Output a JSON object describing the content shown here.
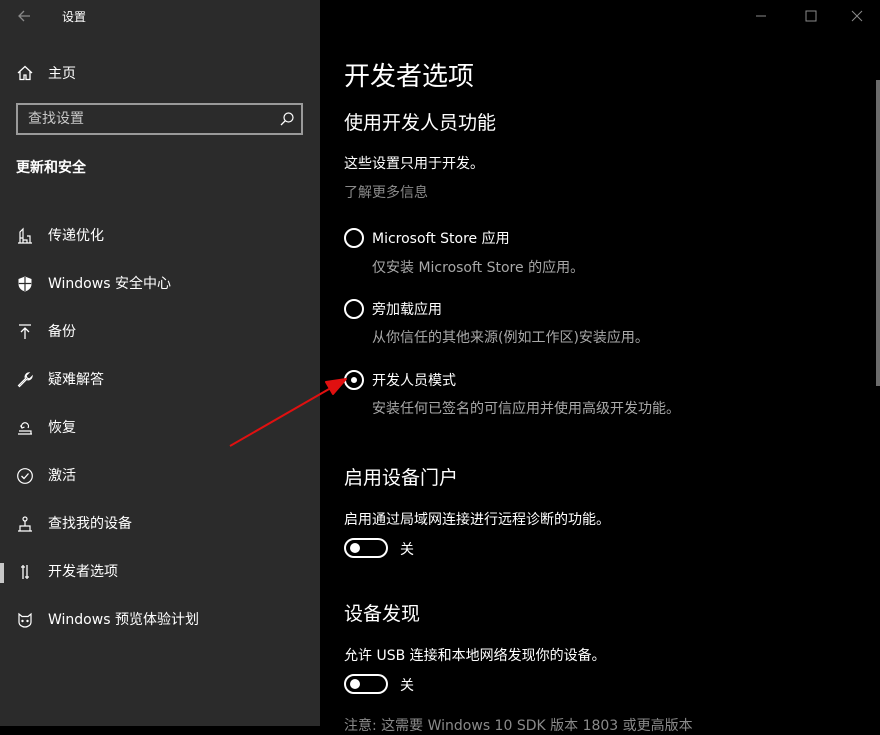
{
  "sidebar": {
    "app_title": "设置",
    "home": {
      "label": "主页",
      "icon": "home-icon"
    },
    "search": {
      "placeholder": "查找设置",
      "icon": "search-icon"
    },
    "section_title": "更新和安全",
    "items": [
      {
        "label": "传递优化",
        "icon": "delivery-optimization-icon",
        "selected": false
      },
      {
        "label": "Windows 安全中心",
        "icon": "shield-icon",
        "selected": false
      },
      {
        "label": "备份",
        "icon": "backup-icon",
        "selected": false
      },
      {
        "label": "疑难解答",
        "icon": "wrench-icon",
        "selected": false
      },
      {
        "label": "恢复",
        "icon": "recovery-icon",
        "selected": false
      },
      {
        "label": "激活",
        "icon": "check-circle-icon",
        "selected": false
      },
      {
        "label": "查找我的设备",
        "icon": "find-device-icon",
        "selected": false
      },
      {
        "label": "开发者选项",
        "icon": "developer-icon",
        "selected": true
      },
      {
        "label": "Windows 预览体验计划",
        "icon": "insider-icon",
        "selected": false
      }
    ]
  },
  "window_controls": [
    "minimize-icon",
    "maximize-icon",
    "close-icon"
  ],
  "main": {
    "page_title": "开发者选项",
    "dev_features": {
      "heading": "使用开发人员功能",
      "description": "这些设置只用于开发。",
      "learn_more": "了解更多信息",
      "options": [
        {
          "label": "Microsoft Store 应用",
          "desc": "仅安装 Microsoft Store 的应用。",
          "selected": false
        },
        {
          "label": "旁加载应用",
          "desc": "从你信任的其他来源(例如工作区)安装应用。",
          "selected": false
        },
        {
          "label": "开发人员模式",
          "desc": "安装任何已签名的可信应用并使用高级开发功能。",
          "selected": true
        }
      ]
    },
    "device_portal": {
      "heading": "启用设备门户",
      "description": "启用通过局域网连接进行远程诊断的功能。",
      "toggle_label": "关",
      "on": false
    },
    "device_discovery": {
      "heading": "设备发现",
      "description": "允许 USB 连接和本地网络发现你的设备。",
      "toggle_label": "关",
      "on": false,
      "note": "注意: 这需要 Windows 10 SDK 版本 1803 或更高版本"
    }
  },
  "colors": {
    "sidebar_bg": "#2b2b2b",
    "content_bg": "#000000",
    "annotation_arrow": "#e01010"
  }
}
